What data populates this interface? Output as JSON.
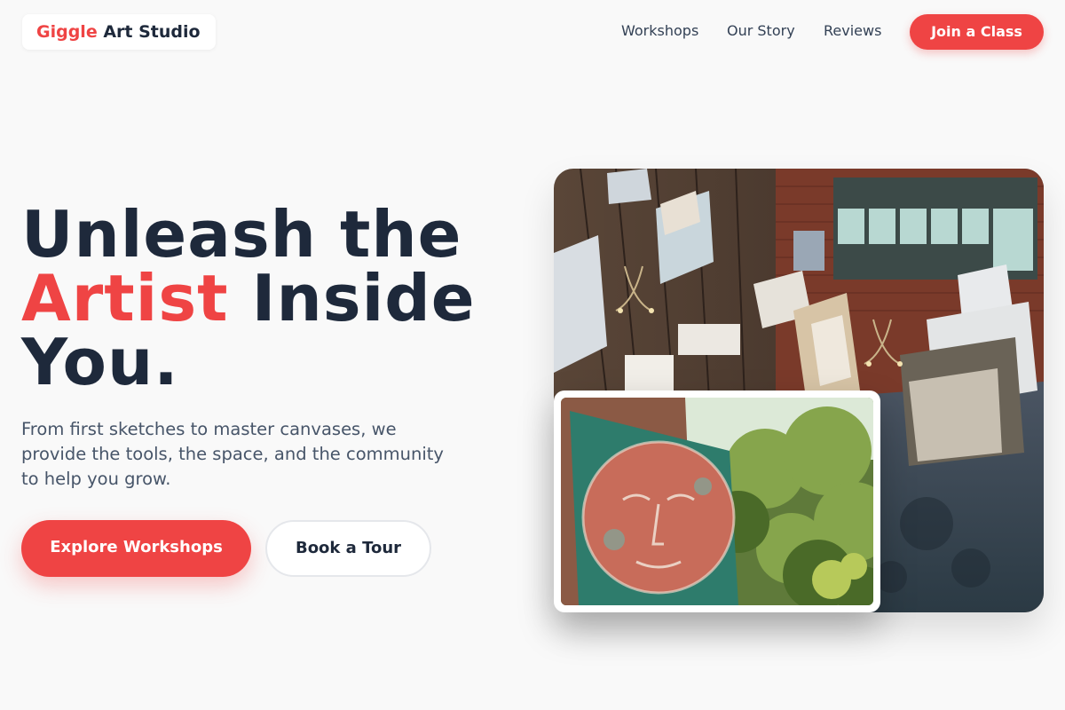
{
  "header": {
    "logo": {
      "accent": "Giggle",
      "rest": " Art Studio"
    },
    "nav": [
      "Workshops",
      "Our Story",
      "Reviews"
    ],
    "cta_label": "Join a Class"
  },
  "hero": {
    "headline_line1": "Unleash the",
    "headline_accent": "Artist",
    "headline_line2_rest": " Inside",
    "headline_line3": "You.",
    "subtext": "From first sketches to master canvases, we provide the tools, the space, and the community to help you grow.",
    "primary_button": "Explore Workshops",
    "secondary_button": "Book a Tour"
  },
  "images": {
    "main": "art-studio-interior-photo",
    "inset": "painted-face-canvas-photo"
  },
  "colors": {
    "accent": "#ef4444",
    "text_dark": "#1e293b",
    "text_muted": "#475569",
    "background": "#f9f9f9"
  }
}
